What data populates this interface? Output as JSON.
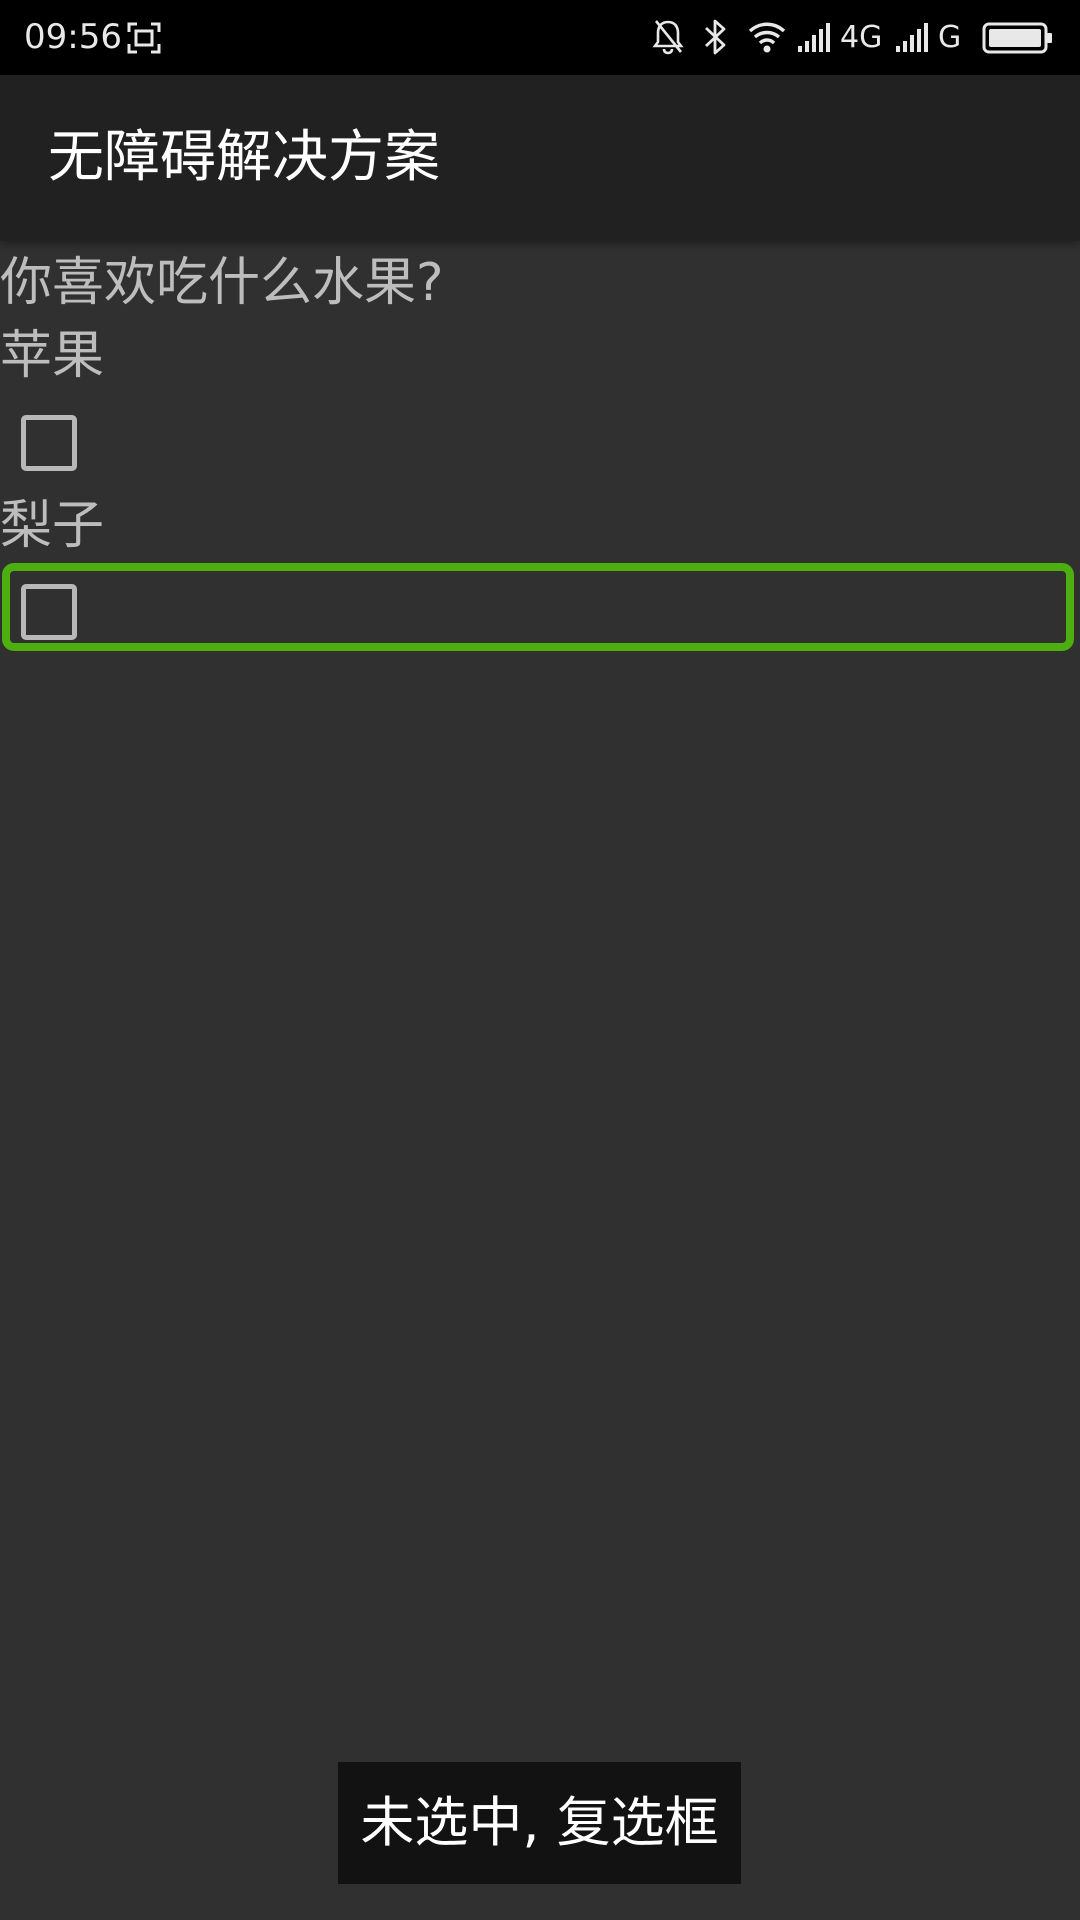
{
  "status_bar": {
    "time": "09:56",
    "network_1": "4G",
    "network_2": "G",
    "icons": [
      "screenshot-icon",
      "bell-off-icon",
      "bluetooth-icon",
      "wifi-icon",
      "signal-icon",
      "signal-icon",
      "battery-icon"
    ]
  },
  "app_bar": {
    "title": "无障碍解决方案"
  },
  "content": {
    "question": "你喜欢吃什么水果?",
    "options": [
      {
        "label": "苹果",
        "checked": false
      },
      {
        "label": "梨子",
        "checked": false
      }
    ]
  },
  "toast": {
    "text": "未选中, 复选框"
  },
  "colors": {
    "background": "#303030",
    "app_bar": "#212121",
    "status_bar": "#000000",
    "focus_ring": "#4caf0f",
    "text_secondary": "#bdbdbd"
  }
}
